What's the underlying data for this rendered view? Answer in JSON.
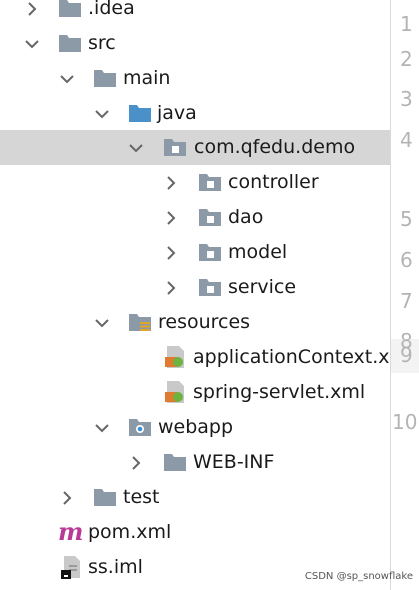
{
  "tree": {
    "idea": ".idea",
    "src": "src",
    "main": "main",
    "java": "java",
    "package": "com.qfedu.demo",
    "controller": "controller",
    "dao": "dao",
    "model": "model",
    "service": "service",
    "resources": "resources",
    "app_context": "applicationContext.x",
    "spring_servlet": "spring-servlet.xml",
    "webapp": "webapp",
    "webinf": "WEB-INF",
    "test": "test",
    "pom": "pom.xml",
    "ssiml": "ss.iml"
  },
  "gutter": {
    "lines": [
      "1",
      "2",
      "3",
      "4",
      "5",
      "6",
      "7",
      "8",
      "9",
      "10"
    ]
  },
  "watermark": "CSDN @sp_snowflake",
  "colors": {
    "folder": "#8c9aa8",
    "source_folder": "#4a90c9",
    "selection": "#d6d6d6",
    "maven": "#b93a96"
  }
}
